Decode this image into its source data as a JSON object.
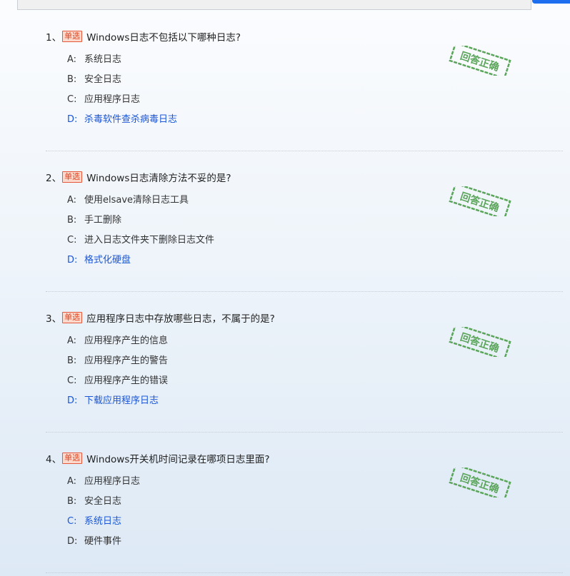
{
  "colors": {
    "correct": "#1a56d6",
    "tag_border": "#e4573b",
    "tag_bg": "#fbd9cc",
    "stamp": "#5aa55a",
    "primary_button": "#1e6ff0"
  },
  "icons": {
    "stamp": "correct-answer-stamp-icon"
  },
  "questions": [
    {
      "number": "1、",
      "tag": "单选",
      "text": "Windows日志不包括以下哪种日志?",
      "stamp_text": "回答正确",
      "options": [
        {
          "letter": "A:",
          "text": "系统日志",
          "correct": false
        },
        {
          "letter": "B:",
          "text": "安全日志",
          "correct": false
        },
        {
          "letter": "C:",
          "text": "应用程序日志",
          "correct": false
        },
        {
          "letter": "D:",
          "text": "杀毒软件查杀病毒日志",
          "correct": true
        }
      ]
    },
    {
      "number": "2、",
      "tag": "单选",
      "text": "Windows日志清除方法不妥的是?",
      "stamp_text": "回答正确",
      "options": [
        {
          "letter": "A:",
          "text": "使用elsave清除日志工具",
          "correct": false
        },
        {
          "letter": "B:",
          "text": "手工删除",
          "correct": false
        },
        {
          "letter": "C:",
          "text": "进入日志文件夹下删除日志文件",
          "correct": false
        },
        {
          "letter": "D:",
          "text": "格式化硬盘",
          "correct": true
        }
      ]
    },
    {
      "number": "3、",
      "tag": "单选",
      "text": "应用程序日志中存放哪些日志，不属于的是?",
      "stamp_text": "回答正确",
      "options": [
        {
          "letter": "A:",
          "text": "应用程序产生的信息",
          "correct": false
        },
        {
          "letter": "B:",
          "text": "应用程序产生的警告",
          "correct": false
        },
        {
          "letter": "C:",
          "text": "应用程序产生的错误",
          "correct": false
        },
        {
          "letter": "D:",
          "text": "下载应用程序日志",
          "correct": true
        }
      ]
    },
    {
      "number": "4、",
      "tag": "单选",
      "text": "Windows开关机时间记录在哪项日志里面?",
      "stamp_text": "回答正确",
      "options": [
        {
          "letter": "A:",
          "text": "应用程序日志",
          "correct": false
        },
        {
          "letter": "B:",
          "text": "安全日志",
          "correct": false
        },
        {
          "letter": "C:",
          "text": "系统日志",
          "correct": true
        },
        {
          "letter": "D:",
          "text": "硬件事件",
          "correct": false
        }
      ]
    }
  ]
}
